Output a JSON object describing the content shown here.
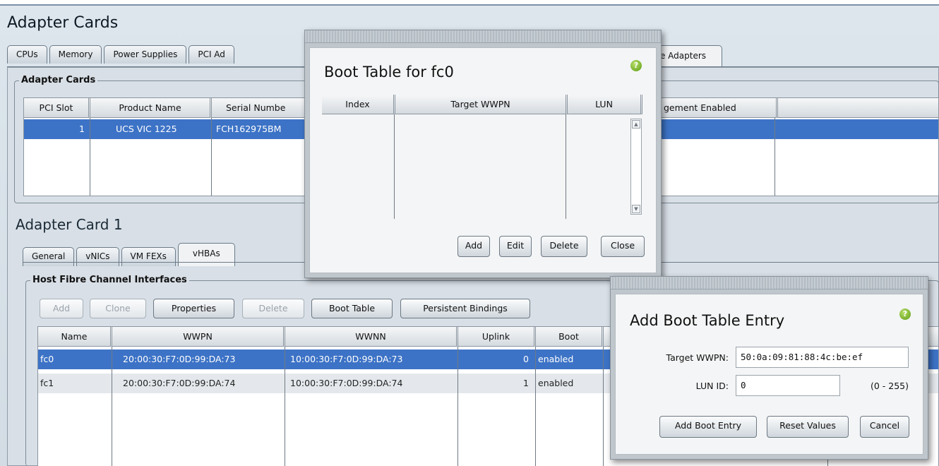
{
  "page_title": "Adapter Cards",
  "top_tabs": [
    "CPUs",
    "Memory",
    "Power Supplies",
    "PCI Ad",
    "age Adapters"
  ],
  "adapter_cards": {
    "legend": "Adapter Cards",
    "columns": [
      "PCI Slot",
      "Product Name",
      "Serial Numbe",
      "gement Enabled"
    ],
    "rows": [
      {
        "slot": "1",
        "product": "UCS VIC 1225",
        "serial": "FCH162975BM"
      }
    ]
  },
  "adapter_card_title": "Adapter Card 1",
  "sub_tabs": [
    "General",
    "vNICs",
    "VM FEXs",
    "vHBAs"
  ],
  "hfc": {
    "legend": "Host Fibre Channel Interfaces",
    "buttons": {
      "add": "Add",
      "clone": "Clone",
      "properties": "Properties",
      "delete": "Delete",
      "boot_table": "Boot Table",
      "persistent_bindings": "Persistent Bindings"
    },
    "columns": [
      "Name",
      "WWPN",
      "WWNN",
      "Uplink",
      "Boot"
    ],
    "rows": [
      {
        "name": "fc0",
        "wwpn": "20:00:30:F7:0D:99:DA:73",
        "wwnn": "10:00:30:F7:0D:99:DA:73",
        "uplink": "0",
        "boot": "enabled"
      },
      {
        "name": "fc1",
        "wwpn": "20:00:30:F7:0D:99:DA:74",
        "wwnn": "10:00:30:F7:0D:99:DA:74",
        "uplink": "1",
        "boot": "enabled"
      }
    ]
  },
  "boot_table_dialog": {
    "title": "Boot Table for fc0",
    "columns": [
      "Index",
      "Target WWPN",
      "LUN"
    ],
    "buttons": {
      "add": "Add",
      "edit": "Edit",
      "delete": "Delete",
      "close": "Close"
    }
  },
  "add_entry_dialog": {
    "title": "Add Boot Table Entry",
    "target_wwpn_label": "Target WWPN:",
    "target_wwpn_value": "50:0a:09:81:88:4c:be:ef",
    "lun_label": "LUN ID:",
    "lun_value": "0",
    "lun_range": "(0 - 255)",
    "buttons": {
      "add_boot_entry": "Add Boot Entry",
      "reset_values": "Reset Values",
      "cancel": "Cancel"
    }
  },
  "icons": {
    "help": "help-icon",
    "scroll_up": "scroll-up-arrow-icon",
    "scroll_down": "scroll-down-arrow-icon"
  },
  "colors": {
    "selection": "#3d73c6",
    "help": "#6aa81c"
  }
}
